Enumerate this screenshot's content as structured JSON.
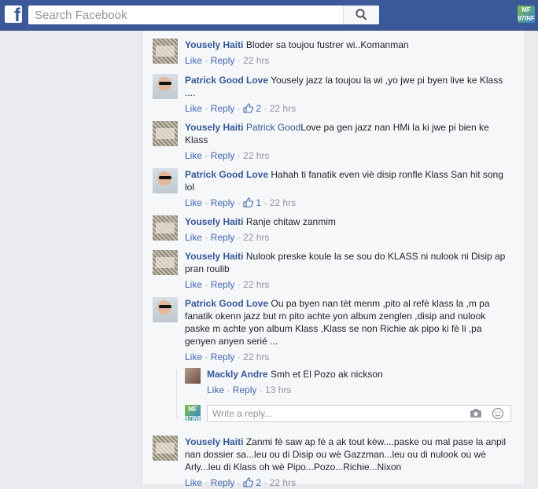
{
  "topbar": {
    "logo_letter": "f",
    "search_placeholder": "Search Facebook",
    "right_logo_text": "MF\n97INF"
  },
  "comments": [
    {
      "name": "Yousely Haiti",
      "text": "Bloder sa toujou fustrer wi..Komanman",
      "like": "Like",
      "reply": "Reply",
      "time": "22 hrs"
    },
    {
      "name": "Patrick Good Love",
      "text": "Yousely jazz la toujou la wi ,yo jwe pi byen live ke Klass ....",
      "like": "Like",
      "reply": "Reply",
      "likes": "2",
      "time": "22 hrs"
    },
    {
      "name": "Yousely Haiti",
      "tag": "Patrick Good",
      "text": "Love pa gen jazz nan HMi la ki jwe pi bien ke Klass",
      "like": "Like",
      "reply": "Reply",
      "time": "22 hrs"
    },
    {
      "name": "Patrick Good Love",
      "text": "Hahah ti fanatik even viè disip ronfle Klass San hit song lol",
      "like": "Like",
      "reply": "Reply",
      "likes": "1",
      "time": "22 hrs"
    },
    {
      "name": "Yousely Haiti",
      "text": "Ranje chitaw zanmim",
      "like": "Like",
      "reply": "Reply",
      "time": "22 hrs"
    },
    {
      "name": "Yousely Haiti",
      "text": "Nulook preske koule la se sou do KLASS ni nulook ni Disip ap pran roulib",
      "like": "Like",
      "reply": "Reply",
      "time": "22 hrs"
    },
    {
      "name": "Patrick Good Love",
      "text": "Ou pa byen nan tèt menm ,pito al refè klass la ,m pa fanatik okenn jazz but m pito achte yon album zenglen ,disip and nulook paske m achte yon album Klass ,Klass se non Richie ak pipo ki fè li ,pa genyen anyen serié ...",
      "like": "Like",
      "reply": "Reply",
      "time": "22 hrs"
    },
    {
      "name": "Yousely Haiti",
      "text": "Zanmi fè saw ap fè a ak tout kèw....paske ou mal pase la anpil nan dossier sa...leu ou di Disip ou wè Gazzman...leu ou di nulook ou wè Arly...leu di Klass oh wè Pipo...Pozo...Richie...Nixon",
      "like": "Like",
      "reply": "Reply",
      "likes": "2",
      "time": "22 hrs"
    }
  ],
  "reply": {
    "name": "Mackly Andre",
    "text": "Smh et El Pozo ak nickson",
    "like": "Like",
    "reply": "Reply",
    "time": "13 hrs"
  },
  "write_reply": {
    "placeholder": "Write a reply...",
    "avatar_text": "MF\n97INF"
  },
  "colors": {
    "topbar": "#3b5998",
    "link": "#365899",
    "meta": "#90949c",
    "panel": "#f6f7f9",
    "page_bg": "#e9ebee"
  }
}
